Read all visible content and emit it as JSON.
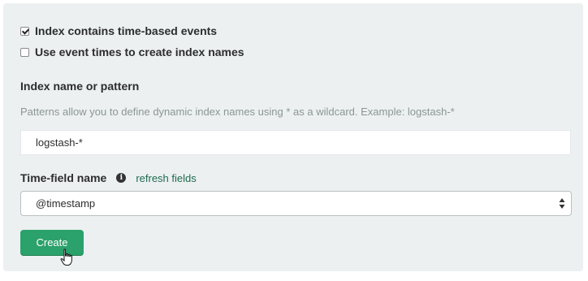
{
  "form": {
    "time_based_checkbox": {
      "label": "Index contains time-based events",
      "checked": true
    },
    "event_times_checkbox": {
      "label": "Use event times to create index names",
      "checked": false
    },
    "index_section": {
      "label": "Index name or pattern",
      "help": "Patterns allow you to define dynamic index names using * as a wildcard. Example: logstash-*",
      "value": "logstash-*"
    },
    "time_field": {
      "label": "Time-field name",
      "info_icon": "info-icon",
      "refresh_link": "refresh fields",
      "selected": "@timestamp"
    },
    "create_button": "Create"
  },
  "colors": {
    "panel_bg": "#ecf0f1",
    "primary_button": "#2ba16b",
    "link": "#1f6b4e",
    "help_text": "#8c9596"
  }
}
